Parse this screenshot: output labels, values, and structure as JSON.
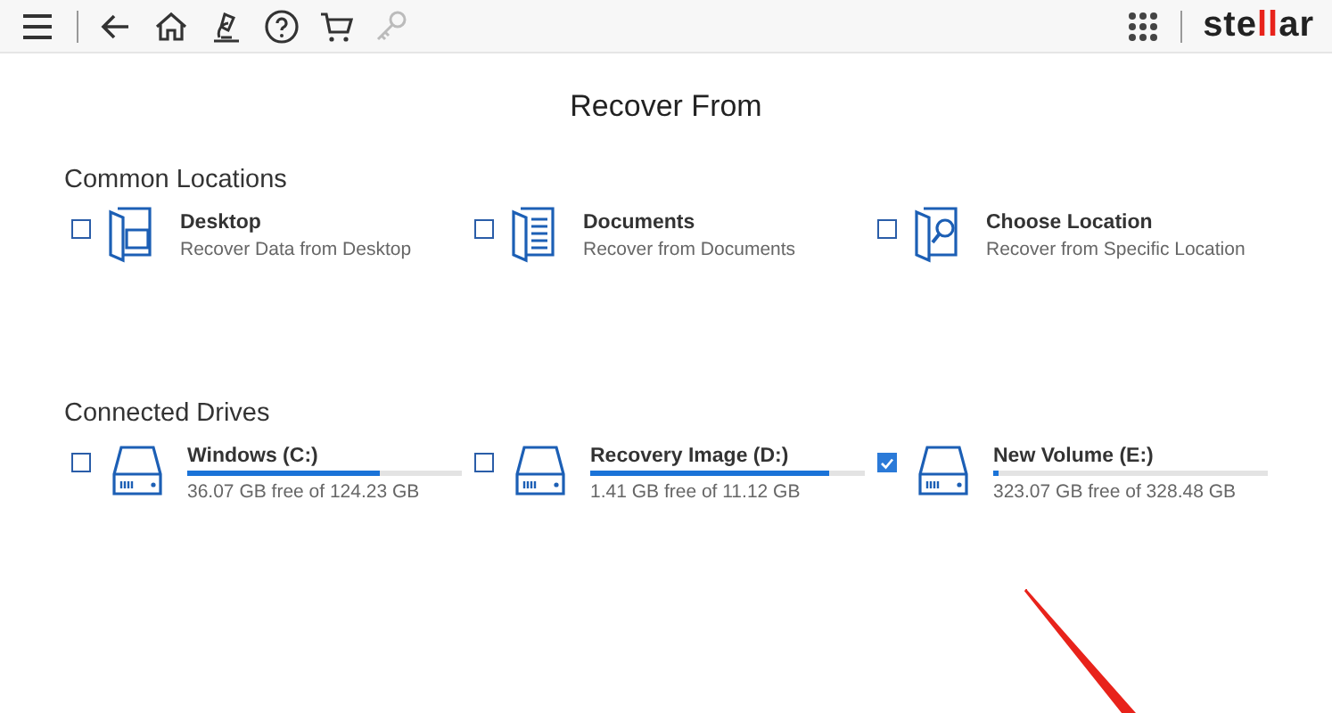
{
  "toolbar": {
    "icons": [
      {
        "kind": "menu"
      },
      {
        "kind": "back"
      },
      {
        "kind": "home"
      },
      {
        "kind": "analyze"
      },
      {
        "kind": "help"
      },
      {
        "kind": "cart"
      },
      {
        "kind": "key",
        "disabled": true
      }
    ]
  },
  "logo": [
    {
      "text": "ste",
      "accent": false
    },
    {
      "text": "ll",
      "accent": true
    },
    {
      "text": "ar",
      "accent": false
    }
  ],
  "title": "Recover From",
  "common_locations": {
    "heading": "Common Locations",
    "items": [
      {
        "kind": "desktop",
        "label": "Desktop",
        "description": "Recover Data from Desktop",
        "checked": false
      },
      {
        "kind": "documents",
        "label": "Documents",
        "description": "Recover from Documents",
        "checked": false
      },
      {
        "kind": "choose",
        "label": "Choose Location",
        "description": "Recover from Specific Location",
        "checked": false
      }
    ]
  },
  "connected_drives": {
    "heading": "Connected Drives",
    "items": [
      {
        "label": "Windows (C:)",
        "level": 0.7,
        "space": "36.07 GB free of 124.23 GB",
        "checked": false
      },
      {
        "label": "Recovery Image (D:)",
        "level": 0.87,
        "space": "1.41 GB free of 11.12 GB",
        "checked": false
      },
      {
        "label": "New Volume (E:)",
        "level": 0.02,
        "space": "323.07 GB free of 328.48 GB",
        "checked": true
      }
    ]
  }
}
